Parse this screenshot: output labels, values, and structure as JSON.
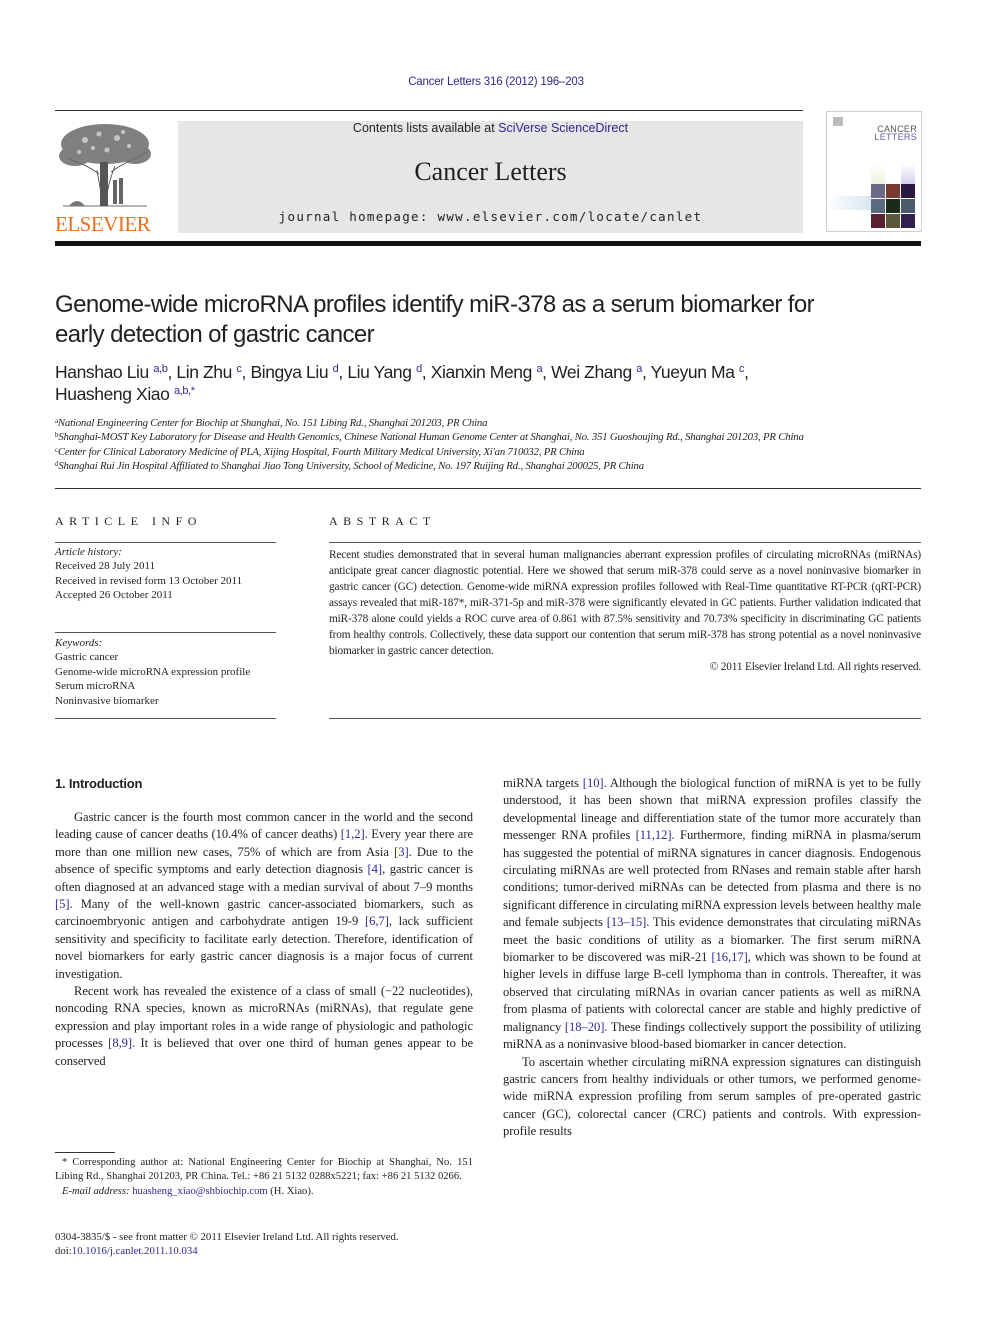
{
  "header": {
    "journal_ref": "Cancer Letters 316 (2012) 196–203",
    "publisher": "ELSEVIER",
    "contents_prefix": "Contents lists available at ",
    "contents_link": "SciVerse ScienceDirect",
    "journal_name": "Cancer Letters",
    "homepage": "journal homepage: www.elsevier.com/locate/canlet",
    "cover": {
      "line1": "CANCER",
      "line2": "LETTERS"
    },
    "colors": {
      "link": "#2e2a8f",
      "publisher_orange": "#e9711c",
      "banner_bg": "#e6e6e6"
    }
  },
  "article": {
    "title_line1": "Genome-wide microRNA profiles identify miR-378 as a serum biomarker for",
    "title_line2": "early detection of gastric cancer",
    "authors": [
      {
        "name": "Hanshao Liu",
        "aff": "a,b",
        "sep": ", "
      },
      {
        "name": "Lin Zhu",
        "aff": "c",
        "sep": ", "
      },
      {
        "name": "Bingya Liu",
        "aff": "d",
        "sep": ", "
      },
      {
        "name": "Liu Yang",
        "aff": "d",
        "sep": ", "
      },
      {
        "name": "Xianxin Meng",
        "aff": "a",
        "sep": ", "
      },
      {
        "name": "Wei Zhang",
        "aff": "a",
        "sep": ", "
      },
      {
        "name": "Yueyun Ma",
        "aff": "c",
        "sep": ","
      },
      {
        "name": "Huasheng Xiao",
        "aff": "a,b,*",
        "sep": ""
      }
    ],
    "affiliations": [
      {
        "key": "a",
        "text": "National Engineering Center for Biochip at Shanghai, No. 151 Libing Rd., Shanghai 201203, PR China"
      },
      {
        "key": "b",
        "text": "Shanghai-MOST Key Laboratory for Disease and Health Genomics, Chinese National Human Genome Center at Shanghai, No. 351 Guoshoujing Rd., Shanghai 201203, PR China"
      },
      {
        "key": "c",
        "text": "Center for Clinical Laboratory Medicine of PLA, Xijing Hospital, Fourth Military Medical University, Xi'an 710032, PR China"
      },
      {
        "key": "d",
        "text": "Shanghai Rui Jin Hospital Affiliated to Shanghai Jiao Tong University, School of Medicine, No. 197 Ruijing Rd., Shanghai 200025, PR China"
      }
    ]
  },
  "article_info": {
    "heading": "ARTICLE INFO",
    "history_label": "Article history:",
    "history": [
      "Received 28 July 2011",
      "Received in revised form 13 October 2011",
      "Accepted 26 October 2011"
    ],
    "keywords_label": "Keywords:",
    "keywords": [
      "Gastric cancer",
      "Genome-wide microRNA expression profile",
      "Serum microRNA",
      "Noninvasive biomarker"
    ]
  },
  "abstract": {
    "heading": "ABSTRACT",
    "text": "Recent studies demonstrated that in several human malignancies aberrant expression profiles of circulating microRNAs (miRNAs) anticipate great cancer diagnostic potential. Here we showed that serum miR-378 could serve as a novel noninvasive biomarker in gastric cancer (GC) detection. Genome-wide miRNA expression profiles followed with Real-Time quantitative RT-PCR (qRT-PCR) assays revealed that miR-187*, miR-371-5p and miR-378 were significantly elevated in GC patients. Further validation indicated that miR-378 alone could yields a ROC curve area of 0.861 with 87.5% sensitivity and 70.73% specificity in discriminating GC patients from healthy controls. Collectively, these data support our contention that serum miR-378 has strong potential as a novel noninvasive biomarker in gastric cancer detection.",
    "copyright": "© 2011 Elsevier Ireland Ltd. All rights reserved."
  },
  "body": {
    "section_heading": "1. Introduction",
    "left_paragraphs": [
      [
        {
          "t": "Gastric cancer is the fourth most common cancer in the world and the second leading cause of cancer deaths (10.4% of cancer deaths) "
        },
        {
          "ref": "[1,2]"
        },
        {
          "t": ". Every year there are more than one million new cases, 75% of which are from Asia "
        },
        {
          "ref": "[3]"
        },
        {
          "t": ". Due to the absence of specific symptoms and early detection diagnosis "
        },
        {
          "ref": "[4]"
        },
        {
          "t": ", gastric cancer is often diagnosed at an advanced stage with a median survival of about 7–9 months "
        },
        {
          "ref": "[5]"
        },
        {
          "t": ". Many of the well-known gastric cancer-associated biomarkers, such as carcinoembryonic antigen and carbohydrate antigen 19-9 "
        },
        {
          "ref": "[6,7]"
        },
        {
          "t": ", lack sufficient sensitivity and specificity to facilitate early detection. Therefore, identification of novel biomarkers for early gastric cancer diagnosis is a major focus of current investigation."
        }
      ],
      [
        {
          "t": "Recent work has revealed the existence of a class of small (−22 nucleotides), noncoding RNA species, known as microRNAs (miRNAs), that regulate gene expression and play important roles in a wide range of physiologic and pathologic processes "
        },
        {
          "ref": "[8,9]"
        },
        {
          "t": ". It is believed that over one third of human genes appear to be conserved"
        }
      ]
    ],
    "right_paragraphs": [
      [
        {
          "t": "miRNA targets "
        },
        {
          "ref": "[10]"
        },
        {
          "t": ". Although the biological function of miRNA is yet to be fully understood, it has been shown that miRNA expression profiles classify the developmental lineage and differentiation state of the tumor more accurately than messenger RNA profiles "
        },
        {
          "ref": "[11,12]"
        },
        {
          "t": ". Furthermore, finding miRNA in plasma/serum has suggested the potential of miRNA signatures in cancer diagnosis. Endogenous circulating miRNAs are well protected from RNases and remain stable after harsh conditions; tumor-derived miRNAs can be detected from plasma and there is no significant difference in circulating miRNA expression levels between healthy male and female subjects "
        },
        {
          "ref": "[13–15]"
        },
        {
          "t": ". This evidence demonstrates that circulating miRNAs meet the basic conditions of utility as a biomarker. The first serum miRNA biomarker to be discovered was miR-21 "
        },
        {
          "ref": "[16,17]"
        },
        {
          "t": ", which was shown to be found at higher levels in diffuse large B-cell lymphoma than in controls. Thereafter, it was observed that circulating miRNAs in ovarian cancer patients as well as miRNA from plasma of patients with colorectal cancer are stable and highly predictive of malignancy "
        },
        {
          "ref": "[18–20]"
        },
        {
          "t": ". These findings collectively support the possibility of utilizing miRNA as a noninvasive blood-based biomarker in cancer detection."
        }
      ],
      [
        {
          "t": "To ascertain whether circulating miRNA expression signatures can distinguish gastric cancers from healthy individuals or other tumors, we performed genome-wide miRNA expression profiling from serum samples of pre-operated gastric cancer (GC), colorectal cancer (CRC) patients and controls. With expression-profile results"
        }
      ]
    ]
  },
  "footnote": {
    "corresponding": "* Corresponding author at: National Engineering Center for Biochip at Shanghai, No. 151 Libing Rd., Shanghai 201203, PR China. Tel.: +86 21 5132 0288x5221; fax: +86 21 5132 0266.",
    "email_label": "E-mail address:",
    "email": "huasheng_xiao@shbiochip.com",
    "email_suffix": " (H. Xiao)."
  },
  "frontmatter": {
    "issn_line": "0304-3835/$ - see front matter © 2011 Elsevier Ireland Ltd. All rights reserved.",
    "doi_label": "doi:",
    "doi": "10.1016/j.canlet.2011.10.034"
  }
}
